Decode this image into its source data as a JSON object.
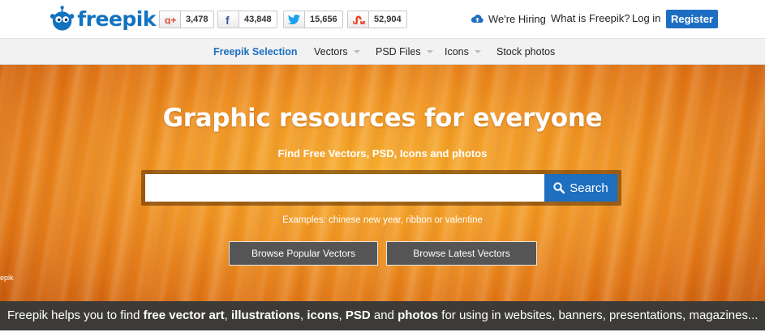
{
  "header": {
    "logo_text": "freepik",
    "social": [
      {
        "icon": "google-plus-icon",
        "count": "3,478",
        "color": "#dd4b39"
      },
      {
        "icon": "facebook-icon",
        "count": "43,848",
        "color": "#3b5998"
      },
      {
        "icon": "twitter-icon",
        "count": "15,656",
        "color": "#1da1f2"
      },
      {
        "icon": "stumbleupon-icon",
        "count": "52,904",
        "color": "#eb4924"
      }
    ],
    "hiring_label": "We're Hiring",
    "what_label": "What is Freepik?",
    "login_label": "Log in",
    "register_label": "Register"
  },
  "nav": {
    "items": [
      {
        "label": "Freepik Selection",
        "active": true
      },
      {
        "label": "Vectors",
        "dropdown": true
      },
      {
        "label": "PSD Files",
        "dropdown": true
      },
      {
        "label": "Icons",
        "dropdown": true
      },
      {
        "label": "Stock photos"
      }
    ]
  },
  "hero": {
    "title": "Graphic resources for everyone",
    "subtitle": "Find Free Vectors, PSD, Icons and photos",
    "search_value": "",
    "search_button": "Search",
    "examples": "Examples: chinese new year, ribbon or valentine",
    "browse_popular": "Browse Popular Vectors",
    "browse_latest": "Browse Latest Vectors",
    "edge_text": "epik"
  },
  "tagline": {
    "parts": [
      {
        "text": "Freepik helps you to find ",
        "bold": false
      },
      {
        "text": "free vector art",
        "bold": true
      },
      {
        "text": ", ",
        "bold": false
      },
      {
        "text": "illustrations",
        "bold": true
      },
      {
        "text": ", ",
        "bold": false
      },
      {
        "text": "icons",
        "bold": true
      },
      {
        "text": ", ",
        "bold": false
      },
      {
        "text": "PSD",
        "bold": true
      },
      {
        "text": " and ",
        "bold": false
      },
      {
        "text": "photos",
        "bold": true
      },
      {
        "text": " for using in websites, banners, presentations, magazines...",
        "bold": false
      }
    ]
  },
  "colors": {
    "brand_blue": "#1273c0",
    "register_bg": "#1d6ec2",
    "hero_orange": "#f09320",
    "tagline_bg": "#3d3b38"
  }
}
